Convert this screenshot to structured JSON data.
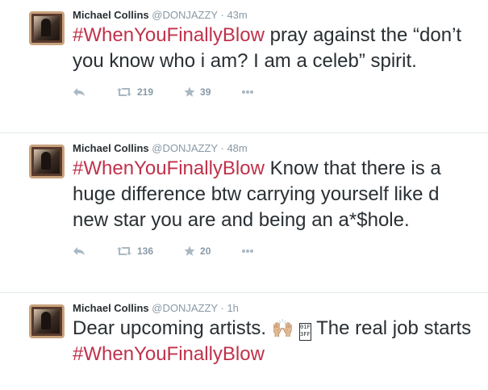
{
  "tweets": [
    {
      "name": "Michael Collins",
      "handle": "@DONJAZZY",
      "dot": "·",
      "time": "43m",
      "hashtag": "#WhenYouFinallyBlow",
      "text": " pray against the “don’t you know who i am? I am a celeb” spirit.",
      "retweets": "219",
      "favorites": "39"
    },
    {
      "name": "Michael Collins",
      "handle": "@DONJAZZY",
      "dot": "·",
      "time": "48m",
      "hashtag": "#WhenYouFinallyBlow",
      "text": " Know that there is a huge difference btw carrying yourself like d new star you are and being an a*$hole.",
      "retweets": "136",
      "favorites": "20"
    },
    {
      "name": "Michael Collins",
      "handle": "@DONJAZZY",
      "dot": "·",
      "time": "1h",
      "text_before": "Dear upcoming artists. ",
      "emoji": "🙌🏼",
      "emoji_missing": "01F 3FF",
      "text_after": " The real job starts ",
      "hashtag": "#WhenYouFinallyBlow"
    }
  ],
  "icons": {
    "reply": "reply-icon",
    "retweet": "retweet-icon",
    "favorite": "star-icon",
    "more": "more-icon"
  },
  "colors": {
    "hashtag": "#c0314a",
    "action_icon": "#aab8c2",
    "meta": "#8899a6"
  }
}
